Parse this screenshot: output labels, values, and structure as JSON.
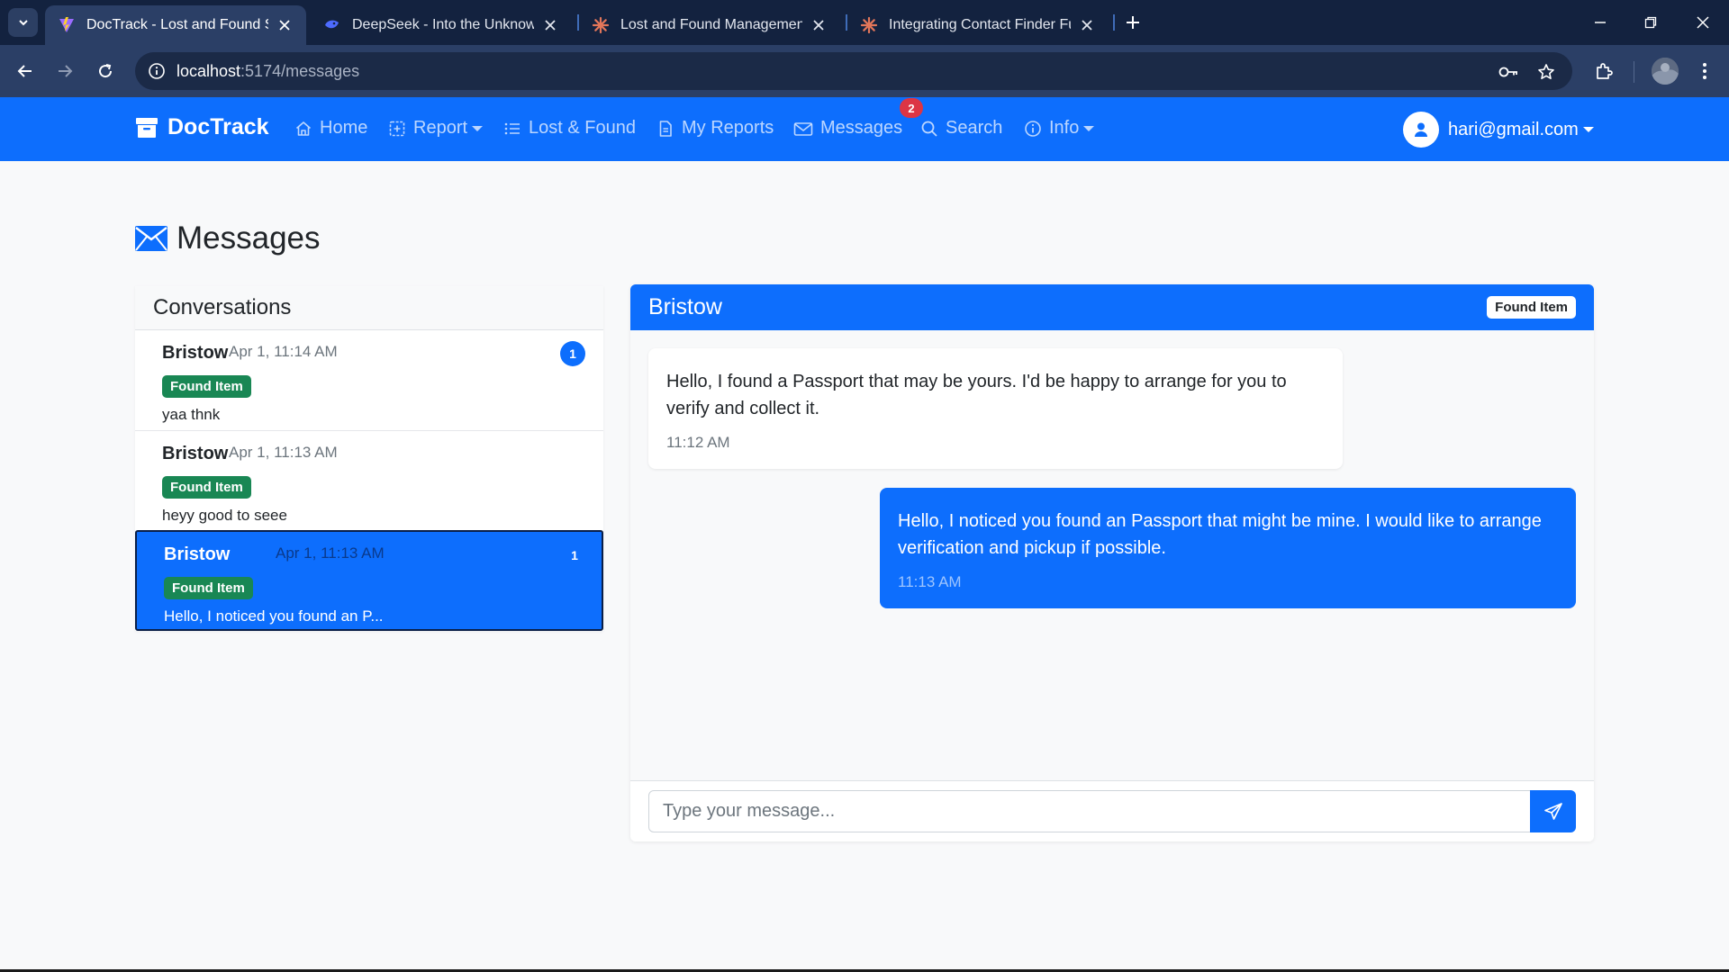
{
  "browser": {
    "tabs": [
      {
        "title": "DocTrack - Lost and Found System",
        "active": true
      },
      {
        "title": "DeepSeek - Into the Unknown",
        "active": false
      },
      {
        "title": "Lost and Found Management System",
        "active": false
      },
      {
        "title": "Integrating Contact Finder Functionality",
        "active": false
      }
    ],
    "url_host": "localhost",
    "url_path": ":5174/messages"
  },
  "navbar": {
    "brand": "DocTrack",
    "links": {
      "home": "Home",
      "report": "Report",
      "lost_found": "Lost & Found",
      "my_reports": "My Reports",
      "messages": "Messages",
      "search": "Search",
      "info": "Info"
    },
    "messages_badge": "2",
    "user_email": "hari@gmail.com"
  },
  "page": {
    "title": "Messages"
  },
  "conversations": {
    "header": "Conversations",
    "items": [
      {
        "name": "Bristow",
        "time": "Apr 1, 11:14 AM",
        "badge": "Found Item",
        "preview": "yaa thnk",
        "unread": "1",
        "selected": false
      },
      {
        "name": "Bristow",
        "time": "Apr 1, 11:13 AM",
        "badge": "Found Item",
        "preview": "heyy good to seee",
        "unread": "",
        "selected": false
      },
      {
        "name": "Bristow",
        "time": "Apr 1, 11:13 AM",
        "badge": "Found Item",
        "preview": "Hello, I noticed you found an P...",
        "unread": "1",
        "selected": true
      }
    ]
  },
  "chat": {
    "name": "Bristow",
    "badge": "Found Item",
    "messages": [
      {
        "direction": "incoming",
        "text": "Hello, I found a Passport that may be yours. I'd be happy to arrange for you to verify and collect it.",
        "time": "11:12 AM"
      },
      {
        "direction": "outgoing",
        "text": "Hello, I noticed you found an Passport that might be mine. I would like to arrange verification and pickup if possible.",
        "time": "11:13 AM"
      }
    ],
    "input_placeholder": "Type your message..."
  },
  "colors": {
    "primary": "#0d6efd",
    "success": "#198754",
    "danger": "#dc3545",
    "chrome_dark": "#13223f",
    "chrome_toolbar": "#2b3f66"
  },
  "icons": {
    "brand": "archive-box-icon",
    "home": "house-icon",
    "report": "plus-square-icon",
    "lost_found": "list-icon",
    "my_reports": "file-text-icon",
    "messages": "envelope-icon",
    "search": "search-icon",
    "info": "info-circle-icon",
    "user": "person-icon",
    "send": "send-icon"
  }
}
